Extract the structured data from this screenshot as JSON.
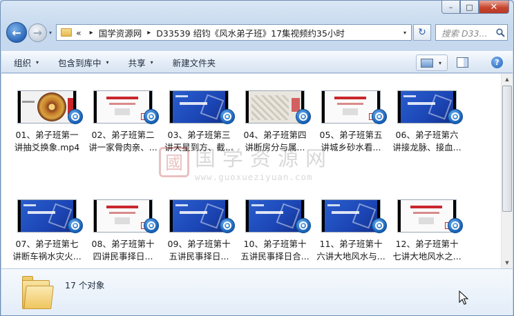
{
  "window": {
    "caption": {
      "minimize": "–",
      "maximize": "□",
      "close": "✕"
    }
  },
  "nav": {
    "back_icon": "←",
    "forward_icon": "→",
    "dropdown_icon": "▾",
    "breadcrumb_prefix": "«",
    "breadcrumb": [
      "国学资源网",
      "D33539 绍钧《风水弟子班》17集视频约35小时"
    ],
    "breadcrumb_sep": "▸",
    "refresh_icon": "↻",
    "search_placeholder": "搜索 D33..."
  },
  "toolbar": {
    "organize": "组织",
    "include_in_library": "包含到库中",
    "share": "共享",
    "new_folder": "新建文件夹",
    "help": "?"
  },
  "files": [
    {
      "line1": "01、弟子班第一",
      "line2": "讲抽爻换象.mp4",
      "thumb": "compass"
    },
    {
      "line1": "02、弟子班第二",
      "line2": "讲一家骨肉亲、...",
      "thumb": "white-red"
    },
    {
      "line1": "03、弟子班第三",
      "line2": "讲天星到方、截...",
      "thumb": "blue"
    },
    {
      "line1": "04、弟子班第四",
      "line2": "讲断房分与属...",
      "thumb": "map"
    },
    {
      "line1": "05、弟子班第五",
      "line2": "讲城乡砂水看...",
      "thumb": "white-red"
    },
    {
      "line1": "06、弟子班第六",
      "line2": "讲接龙脉、接血...",
      "thumb": "blue"
    },
    {
      "line1": "07、弟子班第七",
      "line2": "讲断车祸水灾火...",
      "thumb": "blue"
    },
    {
      "line1": "08、弟子班第十",
      "line2": "四讲民事择日...",
      "thumb": "white-red"
    },
    {
      "line1": "09、弟子班第十",
      "line2": "五讲民事择日...",
      "thumb": "blue"
    },
    {
      "line1": "10、弟子班第十",
      "line2": "五讲民事择日合...",
      "thumb": "blue"
    },
    {
      "line1": "11、弟子班第十",
      "line2": "六讲大地风水与...",
      "thumb": "blue"
    },
    {
      "line1": "12、弟子班第十",
      "line2": "七讲大地风水之...",
      "thumb": "white-red"
    }
  ],
  "watermark": {
    "seal": "國",
    "big": "国学资源网",
    "small": "www.guoxueziyuan.com"
  },
  "details": {
    "count": "17 个对象"
  },
  "colors": {
    "accent": "#1e5fb8",
    "thumb_blue": "#1c46b5",
    "thumb_red": "#c9262b"
  }
}
